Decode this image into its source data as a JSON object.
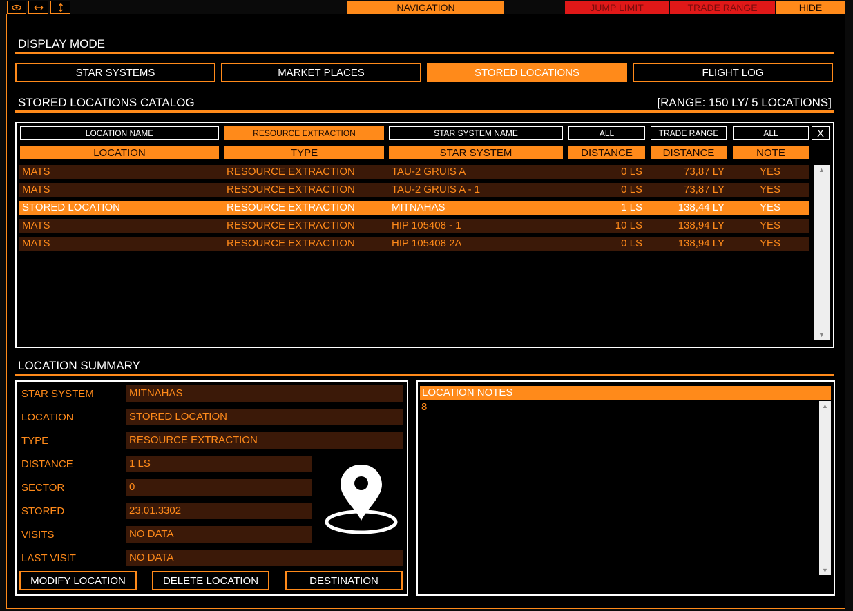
{
  "topbar": {
    "icons": [
      "eye-icon",
      "horizontal-arrows-icon",
      "vertical-arrows-icon"
    ],
    "navigation": "NAVIGATION",
    "jump_limit": "JUMP LIMIT",
    "trade_range": "TRADE RANGE",
    "hide": "HIDE"
  },
  "display_mode": {
    "title": "DISPLAY MODE",
    "buttons": [
      "STAR SYSTEMS",
      "MARKET PLACES",
      "STORED LOCATIONS",
      "FLIGHT LOG"
    ],
    "active": "STORED LOCATIONS"
  },
  "catalog": {
    "title": "STORED LOCATIONS CATALOG",
    "range_info": "[RANGE: 150 LY/ 5 LOCATIONS]",
    "filters": [
      "LOCATION NAME",
      "RESOURCE EXTRACTION",
      "STAR SYSTEM NAME",
      "ALL",
      "TRADE RANGE",
      "ALL",
      "X"
    ],
    "columns": [
      "LOCATION",
      "TYPE",
      "STAR SYSTEM",
      "DISTANCE",
      "DISTANCE",
      "NOTE"
    ],
    "rows": [
      {
        "location": "MATS",
        "type": "RESOURCE EXTRACTION",
        "system": "TAU-2 GRUIS A",
        "dist": "0 LS",
        "ly": "73,87 LY",
        "note": "YES",
        "selected": false
      },
      {
        "location": "MATS",
        "type": "RESOURCE EXTRACTION",
        "system": "TAU-2 GRUIS A - 1",
        "dist": "0 LS",
        "ly": "73,87 LY",
        "note": "YES",
        "selected": false
      },
      {
        "location": "STORED LOCATION",
        "type": "RESOURCE EXTRACTION",
        "system": "MITNAHAS",
        "dist": "1 LS",
        "ly": "138,44 LY",
        "note": "YES",
        "selected": true
      },
      {
        "location": "MATS",
        "type": "RESOURCE EXTRACTION",
        "system": "HIP 105408 - 1",
        "dist": "10 LS",
        "ly": "138,94 LY",
        "note": "YES",
        "selected": false
      },
      {
        "location": "MATS",
        "type": "RESOURCE EXTRACTION",
        "system": "HIP 105408 2A",
        "dist": "0 LS",
        "ly": "138,94 LY",
        "note": "YES",
        "selected": false
      }
    ]
  },
  "summary": {
    "title": "LOCATION SUMMARY",
    "fields": [
      {
        "label": "STAR SYSTEM",
        "value": "MITNAHAS"
      },
      {
        "label": "LOCATION",
        "value": "STORED LOCATION"
      },
      {
        "label": "TYPE",
        "value": "RESOURCE EXTRACTION"
      },
      {
        "label": "DISTANCE",
        "value": "1 LS"
      },
      {
        "label": "SECTOR",
        "value": "0"
      },
      {
        "label": "STORED",
        "value": "23.01.3302"
      },
      {
        "label": "VISITS",
        "value": "NO DATA"
      },
      {
        "label": "LAST VISIT",
        "value": "NO DATA"
      }
    ],
    "icon": "map-pin-icon",
    "buttons": [
      "MODIFY LOCATION",
      "DELETE LOCATION",
      "DESTINATION"
    ]
  },
  "notes": {
    "title": "LOCATION NOTES",
    "text": "8"
  },
  "colors": {
    "accent": "#ff8a1a",
    "row_bg": "#3b1908",
    "alert": "#e01818"
  }
}
